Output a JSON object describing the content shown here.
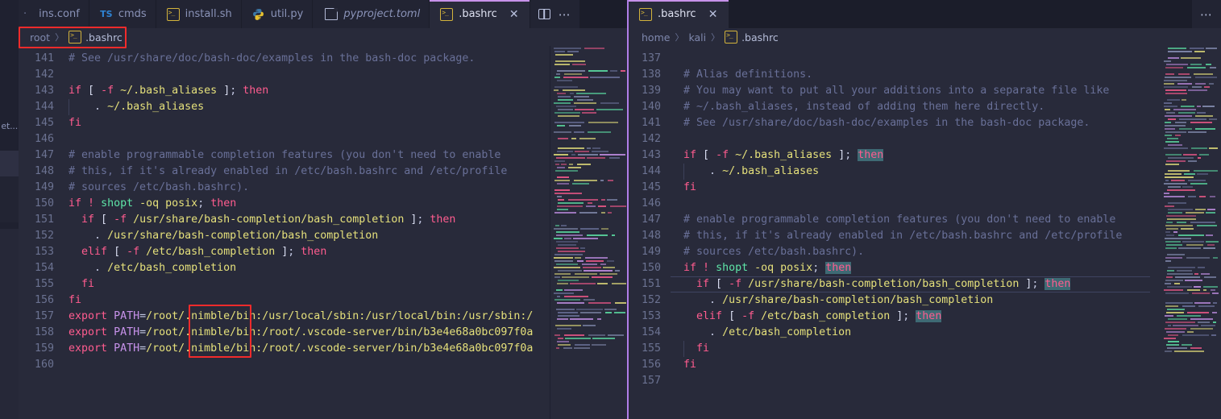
{
  "window": {
    "title": "Visual Studio Code"
  },
  "rail": {
    "fragment_label": "et..."
  },
  "editor_groups": [
    {
      "id": "left",
      "tabs": [
        {
          "label": "ins.conf",
          "icon": "gear-conf-icon",
          "active": false,
          "italic": false,
          "truncated": true
        },
        {
          "label": "cmds",
          "icon": "typescript-icon",
          "active": false,
          "italic": false
        },
        {
          "label": "install.sh",
          "icon": "shell-icon",
          "active": false,
          "italic": false
        },
        {
          "label": "util.py",
          "icon": "python-icon",
          "active": false,
          "italic": false
        },
        {
          "label": "pyproject.toml",
          "icon": "toml-file-icon",
          "active": false,
          "italic": true
        },
        {
          "label": ".bashrc",
          "icon": "shell-icon",
          "active": true,
          "italic": false,
          "close_glyph": "✕"
        }
      ],
      "actions": {
        "split_editor": "split-editor-icon",
        "more": "⋯"
      },
      "breadcrumb": {
        "root": "root",
        "separator": "〉",
        "file_icon": "shell-icon",
        "file": ".bashrc"
      },
      "first_line_number": 141,
      "lines": [
        {
          "n": 141,
          "tokens": [
            {
              "t": "# See /usr/share/doc/bash-doc/examples in the bash-doc package.",
              "c": "c-com"
            }
          ]
        },
        {
          "n": 142,
          "tokens": []
        },
        {
          "n": 143,
          "tokens": [
            {
              "t": "if",
              "c": "c-kw"
            },
            {
              "t": " ",
              "c": "c-pun"
            },
            {
              "t": "[",
              "c": "c-par"
            },
            {
              "t": " ",
              "c": "c-pun"
            },
            {
              "t": "-f",
              "c": "c-kw"
            },
            {
              "t": " ",
              "c": "c-pun"
            },
            {
              "t": "~/.bash_aliases",
              "c": "c-str"
            },
            {
              "t": " ",
              "c": "c-pun"
            },
            {
              "t": "]",
              "c": "c-par"
            },
            {
              "t": ";",
              "c": "c-pun"
            },
            {
              "t": " ",
              "c": "c-pun"
            },
            {
              "t": "then",
              "c": "c-kw"
            }
          ]
        },
        {
          "n": 144,
          "tokens": [
            {
              "t": "    ",
              "c": "c-pun"
            },
            {
              "t": ".",
              "c": "c-pun"
            },
            {
              "t": " ",
              "c": "c-pun"
            },
            {
              "t": "~/.bash_aliases",
              "c": "c-str"
            }
          ],
          "indent_guide": true
        },
        {
          "n": 145,
          "tokens": [
            {
              "t": "fi",
              "c": "c-kw"
            }
          ]
        },
        {
          "n": 146,
          "tokens": []
        },
        {
          "n": 147,
          "tokens": [
            {
              "t": "# enable programmable completion features (you don't need to enable",
              "c": "c-com"
            }
          ]
        },
        {
          "n": 148,
          "tokens": [
            {
              "t": "# this, if it's already enabled in /etc/bash.bashrc and /etc/profile",
              "c": "c-com"
            }
          ]
        },
        {
          "n": 149,
          "tokens": [
            {
              "t": "# sources /etc/bash.bashrc).",
              "c": "c-com"
            }
          ]
        },
        {
          "n": 150,
          "tokens": [
            {
              "t": "if",
              "c": "c-kw"
            },
            {
              "t": " ",
              "c": "c-pun"
            },
            {
              "t": "!",
              "c": "c-kw"
            },
            {
              "t": " ",
              "c": "c-pun"
            },
            {
              "t": "shopt",
              "c": "c-fn"
            },
            {
              "t": " ",
              "c": "c-pun"
            },
            {
              "t": "-oq",
              "c": "c-str"
            },
            {
              "t": " ",
              "c": "c-pun"
            },
            {
              "t": "posix",
              "c": "c-str"
            },
            {
              "t": ";",
              "c": "c-pun"
            },
            {
              "t": " ",
              "c": "c-pun"
            },
            {
              "t": "then",
              "c": "c-kw"
            }
          ]
        },
        {
          "n": 151,
          "tokens": [
            {
              "t": "  ",
              "c": "c-pun"
            },
            {
              "t": "if",
              "c": "c-kw"
            },
            {
              "t": " ",
              "c": "c-pun"
            },
            {
              "t": "[",
              "c": "c-par"
            },
            {
              "t": " ",
              "c": "c-pun"
            },
            {
              "t": "-f",
              "c": "c-kw"
            },
            {
              "t": " ",
              "c": "c-pun"
            },
            {
              "t": "/usr/share/bash-completion/bash_completion",
              "c": "c-str"
            },
            {
              "t": " ",
              "c": "c-pun"
            },
            {
              "t": "]",
              "c": "c-par"
            },
            {
              "t": ";",
              "c": "c-pun"
            },
            {
              "t": " ",
              "c": "c-pun"
            },
            {
              "t": "then",
              "c": "c-kw"
            }
          ]
        },
        {
          "n": 152,
          "tokens": [
            {
              "t": "    ",
              "c": "c-pun"
            },
            {
              "t": ".",
              "c": "c-pun"
            },
            {
              "t": " ",
              "c": "c-pun"
            },
            {
              "t": "/usr/share/bash-completion/bash_completion",
              "c": "c-str"
            }
          ]
        },
        {
          "n": 153,
          "tokens": [
            {
              "t": "  ",
              "c": "c-pun"
            },
            {
              "t": "elif",
              "c": "c-kw"
            },
            {
              "t": " ",
              "c": "c-pun"
            },
            {
              "t": "[",
              "c": "c-par"
            },
            {
              "t": " ",
              "c": "c-pun"
            },
            {
              "t": "-f",
              "c": "c-kw"
            },
            {
              "t": " ",
              "c": "c-pun"
            },
            {
              "t": "/etc/bash_completion",
              "c": "c-str"
            },
            {
              "t": " ",
              "c": "c-pun"
            },
            {
              "t": "]",
              "c": "c-par"
            },
            {
              "t": ";",
              "c": "c-pun"
            },
            {
              "t": " ",
              "c": "c-pun"
            },
            {
              "t": "then",
              "c": "c-kw"
            }
          ]
        },
        {
          "n": 154,
          "tokens": [
            {
              "t": "    ",
              "c": "c-pun"
            },
            {
              "t": ".",
              "c": "c-pun"
            },
            {
              "t": " ",
              "c": "c-pun"
            },
            {
              "t": "/etc/bash_completion",
              "c": "c-str"
            }
          ]
        },
        {
          "n": 155,
          "tokens": [
            {
              "t": "  ",
              "c": "c-pun"
            },
            {
              "t": "fi",
              "c": "c-kw"
            }
          ]
        },
        {
          "n": 156,
          "tokens": [
            {
              "t": "fi",
              "c": "c-kw"
            }
          ]
        },
        {
          "n": 157,
          "tokens": [
            {
              "t": "export",
              "c": "c-kw"
            },
            {
              "t": " ",
              "c": "c-pun"
            },
            {
              "t": "PATH",
              "c": "c-var"
            },
            {
              "t": "=",
              "c": "c-pun"
            },
            {
              "t": "/root/.nimble/bin:/usr/local/sbin:/usr/local/bin:/usr/sbin:/",
              "c": "c-str"
            }
          ]
        },
        {
          "n": 158,
          "tokens": [
            {
              "t": "export",
              "c": "c-kw"
            },
            {
              "t": " ",
              "c": "c-pun"
            },
            {
              "t": "PATH",
              "c": "c-var"
            },
            {
              "t": "=",
              "c": "c-pun"
            },
            {
              "t": "/root/.nimble/bin:/root/.vscode-server/bin/b3e4e68a0bc097f0a",
              "c": "c-str"
            }
          ]
        },
        {
          "n": 159,
          "tokens": [
            {
              "t": "export",
              "c": "c-kw"
            },
            {
              "t": " ",
              "c": "c-pun"
            },
            {
              "t": "PATH",
              "c": "c-var"
            },
            {
              "t": "=",
              "c": "c-pun"
            },
            {
              "t": "/root/.nimble/bin:/root/.vscode-server/bin/b3e4e68a0bc097f0a",
              "c": "c-str"
            }
          ]
        },
        {
          "n": 160,
          "tokens": []
        }
      ]
    },
    {
      "id": "right",
      "tabs": [
        {
          "label": ".bashrc",
          "icon": "shell-icon",
          "active": true,
          "italic": false,
          "close_glyph": "✕"
        }
      ],
      "actions": {
        "more": "⋯"
      },
      "breadcrumb": {
        "root": "home",
        "mid": "kali",
        "separator": "〉",
        "file_icon": "shell-icon",
        "file": ".bashrc"
      },
      "first_line_number": 137,
      "current_line": 151,
      "lines": [
        {
          "n": 137,
          "tokens": []
        },
        {
          "n": 138,
          "tokens": [
            {
              "t": "# Alias definitions.",
              "c": "c-com"
            }
          ]
        },
        {
          "n": 139,
          "tokens": [
            {
              "t": "# You may want to put all your additions into a separate file like",
              "c": "c-com"
            }
          ]
        },
        {
          "n": 140,
          "tokens": [
            {
              "t": "# ~/.bash_aliases, instead of adding them here directly.",
              "c": "c-com"
            }
          ]
        },
        {
          "n": 141,
          "tokens": [
            {
              "t": "# See /usr/share/doc/bash-doc/examples in the bash-doc package.",
              "c": "c-com"
            }
          ]
        },
        {
          "n": 142,
          "tokens": []
        },
        {
          "n": 143,
          "tokens": [
            {
              "t": "if",
              "c": "c-kw"
            },
            {
              "t": " ",
              "c": "c-pun"
            },
            {
              "t": "[",
              "c": "c-par"
            },
            {
              "t": " ",
              "c": "c-pun"
            },
            {
              "t": "-f",
              "c": "c-kw"
            },
            {
              "t": " ",
              "c": "c-pun"
            },
            {
              "t": "~/.bash_aliases",
              "c": "c-str"
            },
            {
              "t": " ",
              "c": "c-pun"
            },
            {
              "t": "]",
              "c": "c-par"
            },
            {
              "t": ";",
              "c": "c-pun"
            },
            {
              "t": " ",
              "c": "c-pun"
            },
            {
              "t": "then",
              "c": "c-kw",
              "hl": true
            }
          ]
        },
        {
          "n": 144,
          "tokens": [
            {
              "t": "    ",
              "c": "c-pun"
            },
            {
              "t": ".",
              "c": "c-pun"
            },
            {
              "t": " ",
              "c": "c-pun"
            },
            {
              "t": "~/.bash_aliases",
              "c": "c-str"
            }
          ],
          "indent_guide": true
        },
        {
          "n": 145,
          "tokens": [
            {
              "t": "fi",
              "c": "c-kw"
            }
          ]
        },
        {
          "n": 146,
          "tokens": []
        },
        {
          "n": 147,
          "tokens": [
            {
              "t": "# enable programmable completion features (you don't need to enable",
              "c": "c-com"
            }
          ]
        },
        {
          "n": 148,
          "tokens": [
            {
              "t": "# this, if it's already enabled in /etc/bash.bashrc and /etc/profile",
              "c": "c-com"
            }
          ]
        },
        {
          "n": 149,
          "tokens": [
            {
              "t": "# sources /etc/bash.bashrc).",
              "c": "c-com"
            }
          ]
        },
        {
          "n": 150,
          "tokens": [
            {
              "t": "if",
              "c": "c-kw"
            },
            {
              "t": " ",
              "c": "c-pun"
            },
            {
              "t": "!",
              "c": "c-kw"
            },
            {
              "t": " ",
              "c": "c-pun"
            },
            {
              "t": "shopt",
              "c": "c-fn"
            },
            {
              "t": " ",
              "c": "c-pun"
            },
            {
              "t": "-oq",
              "c": "c-str"
            },
            {
              "t": " ",
              "c": "c-pun"
            },
            {
              "t": "posix",
              "c": "c-str"
            },
            {
              "t": ";",
              "c": "c-pun"
            },
            {
              "t": " ",
              "c": "c-pun"
            },
            {
              "t": "then",
              "c": "c-kw",
              "hl": true
            }
          ]
        },
        {
          "n": 151,
          "tokens": [
            {
              "t": "  ",
              "c": "c-pun"
            },
            {
              "t": "if",
              "c": "c-kw"
            },
            {
              "t": " ",
              "c": "c-pun"
            },
            {
              "t": "[",
              "c": "c-par"
            },
            {
              "t": " ",
              "c": "c-pun"
            },
            {
              "t": "-f",
              "c": "c-kw"
            },
            {
              "t": " ",
              "c": "c-pun"
            },
            {
              "t": "/usr/share/bash-completion/bash_completion",
              "c": "c-str"
            },
            {
              "t": " ",
              "c": "c-pun"
            },
            {
              "t": "]",
              "c": "c-par"
            },
            {
              "t": ";",
              "c": "c-pun"
            },
            {
              "t": " ",
              "c": "c-pun"
            },
            {
              "t": "then",
              "c": "c-kw",
              "hl": true
            }
          ],
          "current": true
        },
        {
          "n": 152,
          "tokens": [
            {
              "t": "    ",
              "c": "c-pun"
            },
            {
              "t": ".",
              "c": "c-pun"
            },
            {
              "t": " ",
              "c": "c-pun"
            },
            {
              "t": "/usr/share/bash-completion/bash_completion",
              "c": "c-str"
            }
          ]
        },
        {
          "n": 153,
          "tokens": [
            {
              "t": "  ",
              "c": "c-pun"
            },
            {
              "t": "elif",
              "c": "c-kw"
            },
            {
              "t": " ",
              "c": "c-pun"
            },
            {
              "t": "[",
              "c": "c-par"
            },
            {
              "t": " ",
              "c": "c-pun"
            },
            {
              "t": "-f",
              "c": "c-kw"
            },
            {
              "t": " ",
              "c": "c-pun"
            },
            {
              "t": "/etc/bash_completion",
              "c": "c-str"
            },
            {
              "t": " ",
              "c": "c-pun"
            },
            {
              "t": "]",
              "c": "c-par"
            },
            {
              "t": ";",
              "c": "c-pun"
            },
            {
              "t": " ",
              "c": "c-pun"
            },
            {
              "t": "then",
              "c": "c-kw",
              "hl": true
            }
          ]
        },
        {
          "n": 154,
          "tokens": [
            {
              "t": "    ",
              "c": "c-pun"
            },
            {
              "t": ".",
              "c": "c-pun"
            },
            {
              "t": " ",
              "c": "c-pun"
            },
            {
              "t": "/etc/bash_completion",
              "c": "c-str"
            }
          ]
        },
        {
          "n": 155,
          "tokens": [
            {
              "t": "  ",
              "c": "c-pun"
            },
            {
              "t": "fi",
              "c": "c-kw"
            }
          ],
          "indent_guide": true
        },
        {
          "n": 156,
          "tokens": [
            {
              "t": "fi",
              "c": "c-kw"
            }
          ]
        },
        {
          "n": 157,
          "tokens": []
        }
      ]
    }
  ],
  "annotations": [
    {
      "name": "breadcrumb-highlight",
      "color": "#f22b2b",
      "target": "left breadcrumb root > .bashrc"
    },
    {
      "name": "nimble-path-highlight",
      "color": "#f22b2b",
      "target": "/.nimble/b in PATH exports lines 157-159"
    }
  ],
  "colors": {
    "editor_background": "#282a3a",
    "tab_inactive_background": "#222433",
    "keyword": "#ff5c8f",
    "comment": "#697098",
    "string": "#e5e07b",
    "function": "#5ee6a8",
    "variable": "#c792ea",
    "line_number": "#6b7291",
    "word_highlight": "#3e6a74",
    "active_group_border": "#b07ee8",
    "annotation": "#f22b2b"
  }
}
